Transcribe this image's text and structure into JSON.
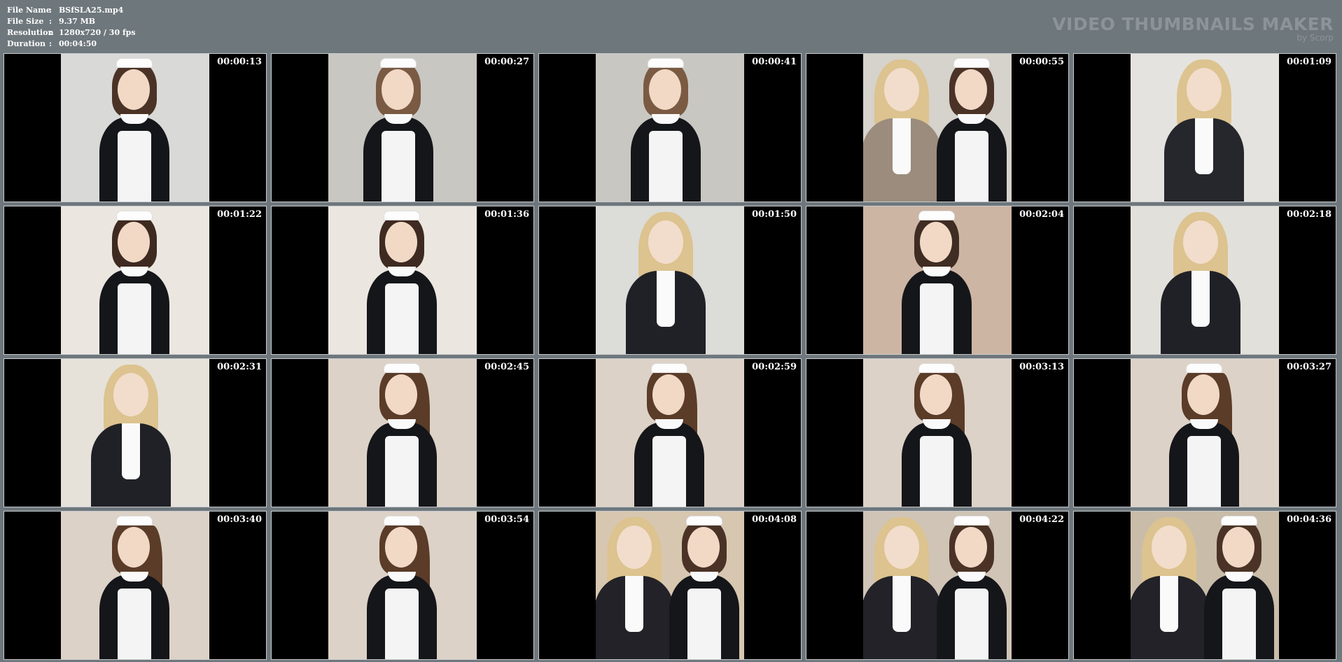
{
  "info": {
    "file_name_label": "File Name",
    "file_name": "BSfSLA25.mp4",
    "file_size_label": "File Size",
    "file_size": "9.37 MB",
    "resolution_label": "Resolution",
    "resolution": "1280x720 / 30 fps",
    "duration_label": "Duration",
    "duration": "00:04:50",
    "separator": ":"
  },
  "brand": {
    "title": "VIDEO THUMBNAILS MAKER",
    "subtitle": "by Scorp"
  },
  "thumbnails": [
    {
      "time": "00:00:13",
      "scene": "maid-solo",
      "bg": "#d9d9d7"
    },
    {
      "time": "00:00:27",
      "scene": "maid-pray",
      "bg": "#c9c7c2"
    },
    {
      "time": "00:00:41",
      "scene": "maid-pray",
      "bg": "#c9c7c2"
    },
    {
      "time": "00:00:55",
      "scene": "lady-and-maid",
      "bg": "#d6d2cc"
    },
    {
      "time": "00:01:09",
      "scene": "lady-office",
      "bg": "#e5e3df"
    },
    {
      "time": "00:01:22",
      "scene": "maid-updo",
      "bg": "#ebe7e0"
    },
    {
      "time": "00:01:36",
      "scene": "maid-updo",
      "bg": "#ebe7e0"
    },
    {
      "time": "00:01:50",
      "scene": "lady-desk",
      "bg": "#dcdcd8"
    },
    {
      "time": "00:02:04",
      "scene": "maid-wall",
      "bg": "#cdb5a3"
    },
    {
      "time": "00:02:18",
      "scene": "lady-desk",
      "bg": "#e2e0da"
    },
    {
      "time": "00:02:31",
      "scene": "lady-desk",
      "bg": "#e6e2da"
    },
    {
      "time": "00:02:45",
      "scene": "maid-ponytail",
      "bg": "#ddd2c7"
    },
    {
      "time": "00:02:59",
      "scene": "maid-ponytail",
      "bg": "#ddd2c7"
    },
    {
      "time": "00:03:13",
      "scene": "maid-ponytail",
      "bg": "#ddd2c7"
    },
    {
      "time": "00:03:27",
      "scene": "maid-ponytail",
      "bg": "#ddd2c7"
    },
    {
      "time": "00:03:40",
      "scene": "maid-ponytail",
      "bg": "#ddd2c7"
    },
    {
      "time": "00:03:54",
      "scene": "maid-ponytail",
      "bg": "#ddd2c7"
    },
    {
      "time": "00:04:08",
      "scene": "lady-and-maid",
      "bg": "#d7c7b0"
    },
    {
      "time": "00:04:22",
      "scene": "lady-and-maid",
      "bg": "#cfc4b6"
    },
    {
      "time": "00:04:36",
      "scene": "lady-and-maid",
      "bg": "#c9bca9"
    }
  ],
  "colors": {
    "background": "#6e777c",
    "thumb_border": "#c7cbcf",
    "brand_text": "#8c949a"
  }
}
